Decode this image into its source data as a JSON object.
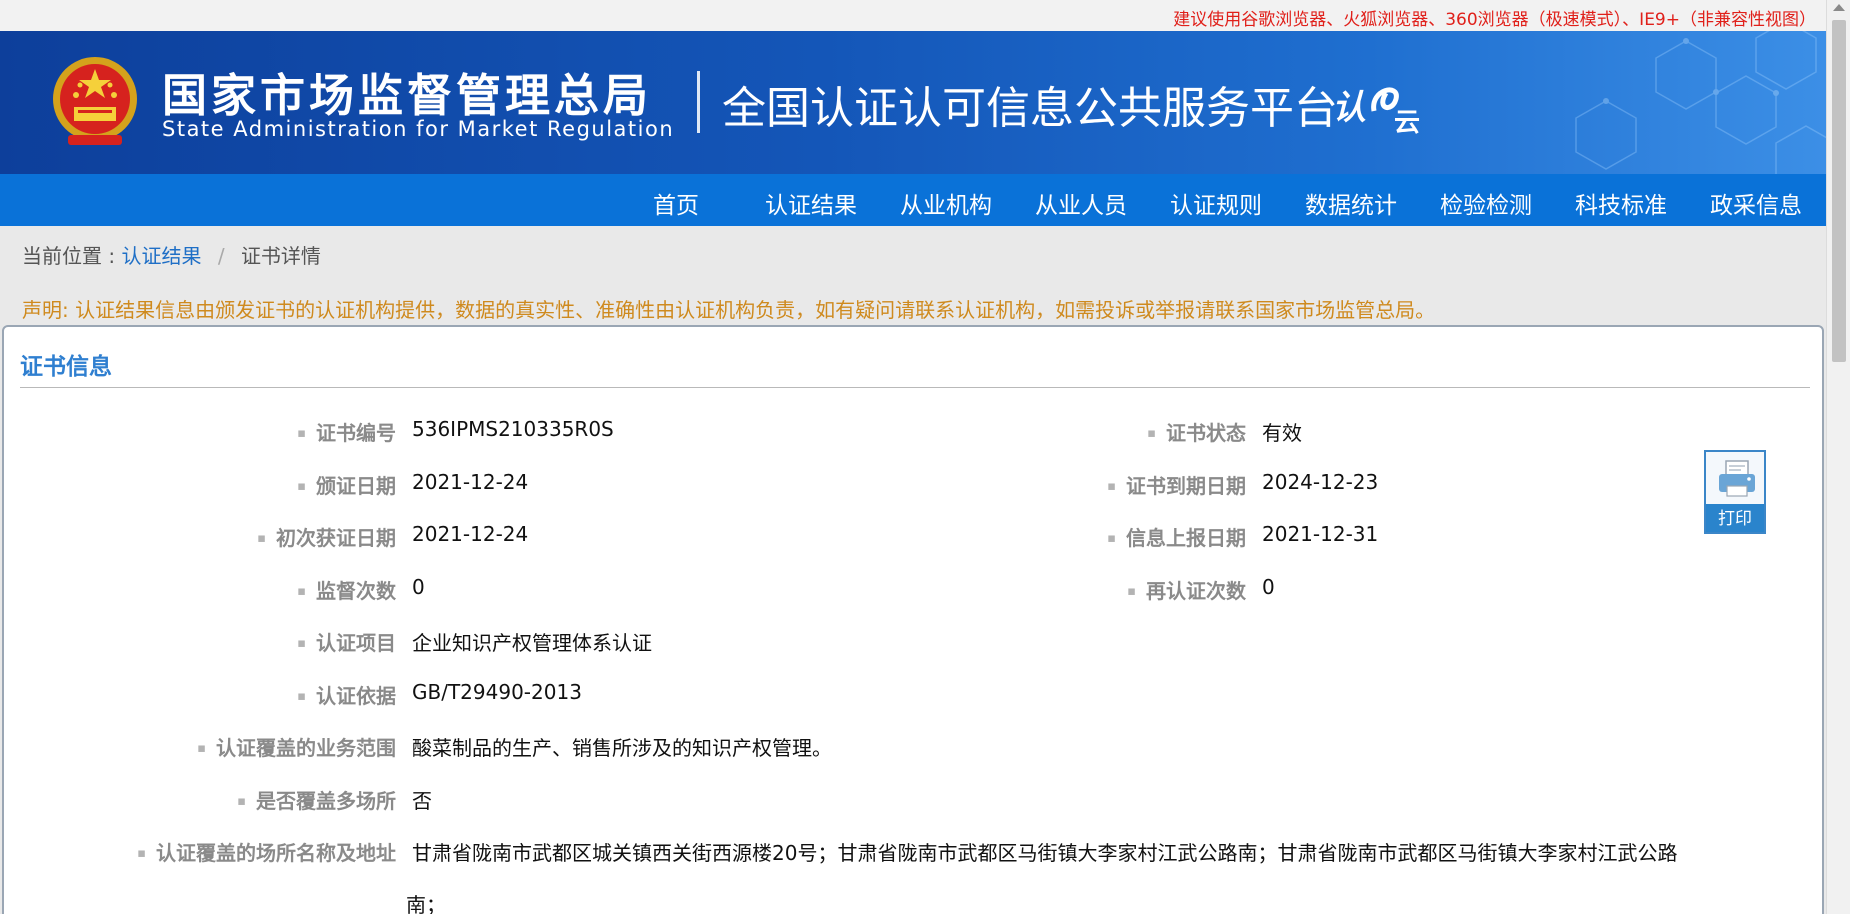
{
  "topbar": {
    "tip": "建议使用谷歌浏览器、火狐浏览器、360浏览器（极速模式）、IE9+（非兼容性视图）"
  },
  "header": {
    "org_cn": "国家市场监督管理总局",
    "org_en": "State Administration  for  Market Regulation",
    "platform": "全国认证认可信息公共服务平台",
    "logo_text": "认e云"
  },
  "nav": [
    {
      "label": "首页"
    },
    {
      "label": "认证结果"
    },
    {
      "label": "从业机构"
    },
    {
      "label": "从业人员"
    },
    {
      "label": "认证规则"
    },
    {
      "label": "数据统计"
    },
    {
      "label": "检验检测"
    },
    {
      "label": "科技标准"
    },
    {
      "label": "政采信息"
    }
  ],
  "breadcrumb": {
    "prefix": "当前位置 :",
    "link": "认证结果",
    "sep": "/",
    "current": "证书详情"
  },
  "notice": "声明: 认证结果信息由颁发证书的认证机构提供，数据的真实性、准确性由认证机构负责，如有疑问请联系认证机构，如需投诉或举报请联系国家市场监管总局。",
  "panel": {
    "title": "证书信息",
    "left_fields": [
      {
        "label": "证书编号",
        "value": "536IPMS210335R0S"
      },
      {
        "label": "颁证日期",
        "value": "2021-12-24"
      },
      {
        "label": "初次获证日期",
        "value": "2021-12-24"
      },
      {
        "label": "监督次数",
        "value": "0"
      },
      {
        "label": "认证项目",
        "value": "企业知识产权管理体系认证"
      },
      {
        "label": "认证依据",
        "value": "GB/T29490-2013"
      },
      {
        "label": "认证覆盖的业务范围",
        "value": "酸菜制品的生产、销售所涉及的知识产权管理。"
      },
      {
        "label": "是否覆盖多场所",
        "value": "否"
      },
      {
        "label": "认证覆盖的场所名称及地址",
        "value": "甘肃省陇南市武都区城关镇西关街西源楼20号；甘肃省陇南市武都区马街镇大李家村江武公路南；甘肃省陇南市武都区马街镇大李家村江武公路",
        "value_cont": "南；"
      }
    ],
    "right_fields": [
      {
        "label": "证书状态",
        "value": "有效"
      },
      {
        "label": "证书到期日期",
        "value": "2024-12-23"
      },
      {
        "label": "信息上报日期",
        "value": "2021-12-31"
      },
      {
        "label": "再认证次数",
        "value": "0"
      }
    ]
  },
  "print_button": {
    "label": "打印",
    "icon": "printer-icon"
  },
  "colors": {
    "banner": "#1456b8",
    "nav": "#0a72d8",
    "notice": "#cf8a1e",
    "tip": "#e0201a",
    "title": "#2f7fd0"
  }
}
